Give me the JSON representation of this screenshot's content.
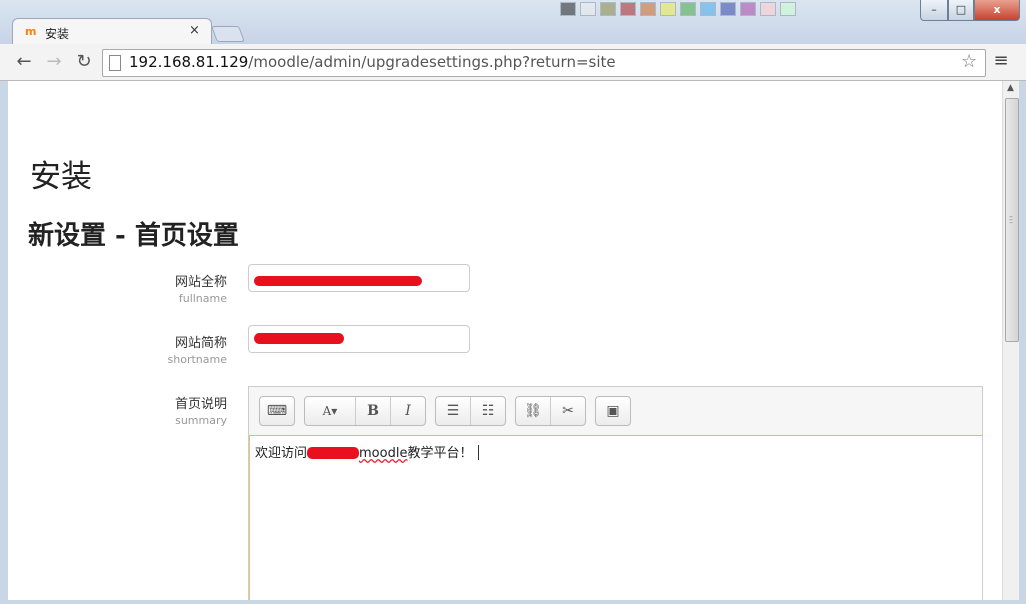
{
  "browser": {
    "tab_title": "安装",
    "tab_favicon": "m",
    "tab_close": "×",
    "url_host": "192.168.81.129",
    "url_path": "/moodle/admin/upgradesettings.php?return=site",
    "back_icon": "←",
    "forward_icon": "→",
    "reload_icon": "↻",
    "star_icon": "☆",
    "menu_icon": "≡",
    "window_minimize": "–",
    "window_maximize": "□",
    "window_close": "x"
  },
  "page": {
    "title": "安装",
    "section_title": "新设置 - 首页设置"
  },
  "form": {
    "fullname": {
      "label": "网站全称",
      "sub": "fullname",
      "value": ""
    },
    "shortname": {
      "label": "网站简称",
      "sub": "shortname",
      "value": ""
    },
    "summary": {
      "label": "首页说明",
      "sub": "summary",
      "text_before": "欢迎访问",
      "text_word": "moodle",
      "text_after": "教学平台！"
    }
  },
  "editor_toolbar": {
    "show_more": "⌨",
    "font_size": "A▾",
    "bold": "B",
    "italic": "I",
    "bullet_list": "☰",
    "numbered_list": "☷",
    "link": "⛓",
    "unlink": "✂",
    "image": "▣"
  },
  "colors": {
    "redaction": "#e8101e",
    "moodle_orange": "#f98012",
    "editor_focus": "#e6b95a"
  }
}
